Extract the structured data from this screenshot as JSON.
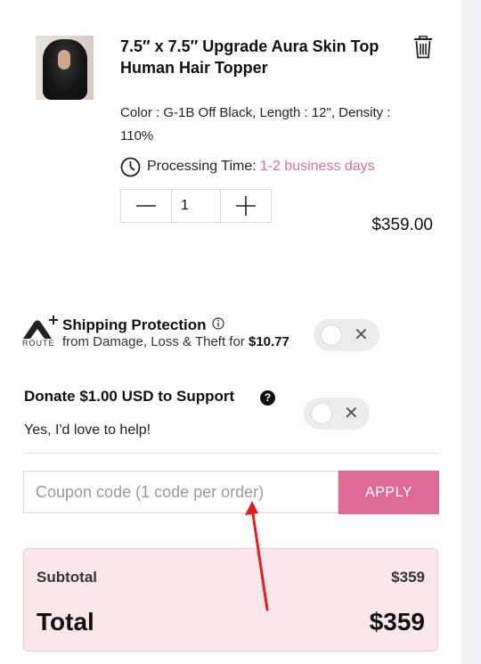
{
  "cart_item": {
    "title": "7.5″ x 7.5″ Upgrade Aura Skin Top Human Hair Topper",
    "variant": "Color : G-1B Off Black, Length : 12\", Density : 110%",
    "processing_label": "Processing Time:",
    "processing_value": "1-2 business days",
    "quantity": "1",
    "price": "$359.00",
    "image_icon": "product-thumbnail",
    "remove_icon": "trash-icon"
  },
  "shipping_protection": {
    "logo_text": "ROUTE",
    "title": "Shipping Protection",
    "subtitle": "from Damage, Loss & Theft for",
    "amount": "$10.77",
    "toggle_state": "off"
  },
  "donation": {
    "title": "Donate $1.00 USD to Support",
    "subtitle": "Yes, I'd love to help!",
    "toggle_state": "off"
  },
  "coupon": {
    "placeholder": "Coupon code (1 code per order)",
    "value": "",
    "apply_label": "APPLY"
  },
  "summary": {
    "subtotal_label": "Subtotal",
    "subtotal_value": "$359",
    "total_label": "Total",
    "total_value": "$359"
  },
  "colors": {
    "accent": "#dd6a97",
    "processing_days": "#d8729a",
    "summary_bg": "#fbe6ec",
    "annotation_arrow": "#e0201d"
  }
}
